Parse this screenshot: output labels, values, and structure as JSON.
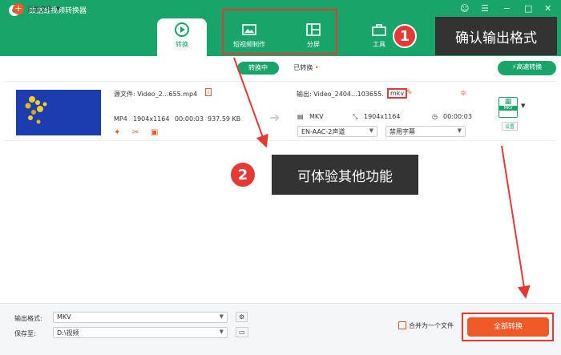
{
  "app": {
    "title": "数据蛙视频转换器"
  },
  "nav": {
    "convert": "转换",
    "short_video": "短视频制作",
    "split_screen": "分屏",
    "tools": "工具"
  },
  "toolbar": {
    "add_file": "添加文件",
    "converting": "转换中",
    "converted": "已转换",
    "fast_convert": "高速转换"
  },
  "file": {
    "source_label": "源文件:",
    "source_name": "Video_2...655.mp4",
    "source_format": "MP4",
    "source_resolution": "1904x1164",
    "source_duration": "00:00:03",
    "source_size": "937.59 KB",
    "output_label": "输出:",
    "output_name": "Video_2404...103655.",
    "output_ext": "mkv",
    "output_format": "MKV",
    "output_resolution": "1904x1164",
    "output_duration": "00:00:03",
    "audio_track": "EN-AAC-2声道",
    "subtitle": "禁用字幕",
    "format_icon_label": "MKV",
    "settings_label": "设置"
  },
  "footer": {
    "output_format_label": "输出格式:",
    "output_format_value": "MKV",
    "save_to_label": "保存至:",
    "save_to_value": "D:\\视频",
    "merge_label": "合并为一个文件",
    "convert_all": "全部转换"
  },
  "annotations": {
    "step1_number": "1",
    "step1_text": "确认输出格式",
    "step2_number": "2",
    "step2_text": "可体验其他功能"
  },
  "colors": {
    "brand_green": "#19a46a",
    "accent_orange": "#f05a28",
    "highlight_red": "#e53935",
    "callout_bg": "#333333"
  }
}
